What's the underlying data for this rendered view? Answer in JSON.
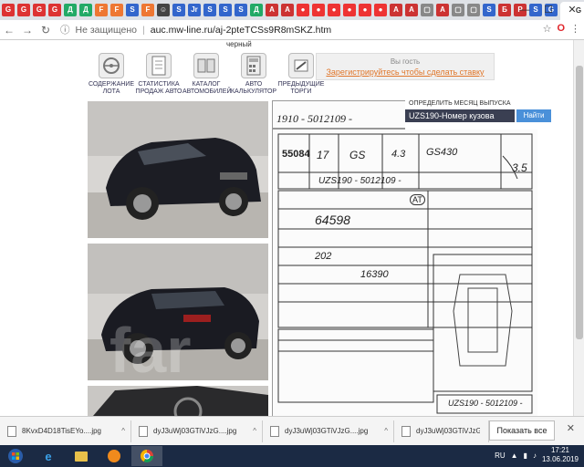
{
  "browser": {
    "active_tab_label": "G",
    "tab_favicons": [
      "G",
      "G",
      "G",
      "G",
      "Д",
      "Д",
      "F",
      "F",
      "S",
      "F",
      "☺",
      "S",
      "Jr",
      "S",
      "S",
      "S",
      "Д",
      "A",
      "A",
      "●",
      "●",
      "●",
      "●",
      "●",
      "●",
      "A",
      "A",
      "▢",
      "A",
      "▢",
      "▢",
      "S",
      "Б",
      "P",
      "S",
      "G"
    ],
    "window_controls": [
      "—",
      "☐",
      "✕"
    ],
    "security_label": "Не защищено",
    "url": "auc.mw-line.ru/aj-2pteTCSs9R8mSKZ.htm",
    "toolbar_icons": [
      "star-icon",
      "opera-icon",
      "menu-icon"
    ]
  },
  "page": {
    "top_cut_text": "черный",
    "nav": [
      {
        "label": "СОДЕРЖАНИЕ ЛОТА"
      },
      {
        "label": "СТАТИСТИКА ПРОДАЖ АВТО"
      },
      {
        "label": "КАТАЛОГ АВТОМОБИЛЕЙ"
      },
      {
        "label": "АВТО КАЛЬКУЛЯТОР"
      },
      {
        "label": "ПРЕДЫДУЩИЕ ТОРГИ"
      }
    ],
    "guest": {
      "line1": "Вы гость",
      "link": "Зарегистрируйтесь чтобы сделать ставку"
    },
    "model_lookup": {
      "label": "ОПРЕДЕЛИТЬ МЕСЯЦ ВЫПУСКА",
      "value": "UZS190-Номер кузова",
      "button": "Найти"
    },
    "sheet": {
      "lot": "55084",
      "header_text": "1910 - 5012109 -",
      "model": "GS",
      "grade": "GS430",
      "engine": "4.3",
      "year": "17",
      "mileage": "64598",
      "chassis": "UZS190 - 5012109 -",
      "color": "202",
      "score": "3.5",
      "trans": "AT",
      "price_note": "16390",
      "footer_chassis": "UZS190 - 5012109 -"
    },
    "watermark": "far"
  },
  "downloads": [
    {
      "name": "8KvxD4D18TisEYo....jpg"
    },
    {
      "name": "dyJ3uWj03GTiVJzG....jpg"
    },
    {
      "name": "dyJ3uWj03GTiVJzG....jpg"
    },
    {
      "name": "dyJ3uWj03GTiVJzG....jpg"
    }
  ],
  "download_bar": {
    "show_all": "Показать все",
    "close": "✕"
  },
  "taskbar": {
    "lang": "RU",
    "time": "17:21",
    "date": "13.06.2019"
  }
}
